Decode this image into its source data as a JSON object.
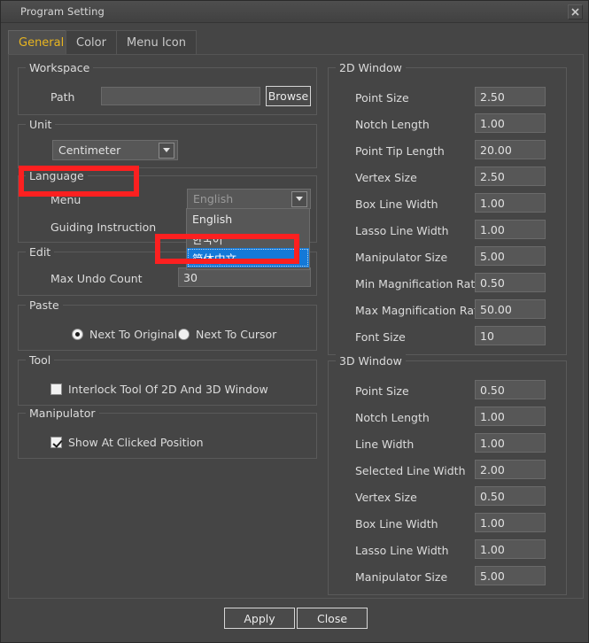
{
  "window": {
    "title": "Program Setting",
    "close_icon": "close-x-icon"
  },
  "tabs": [
    {
      "label": "General",
      "active": true
    },
    {
      "label": "Color",
      "active": false
    },
    {
      "label": "Menu Icon",
      "active": false
    }
  ],
  "left_panel": {
    "workspace": {
      "legend": "Workspace",
      "path_label": "Path",
      "path_value": "",
      "path_placeholder": "",
      "browse_label": "Browse"
    },
    "unit": {
      "legend": "Unit",
      "value": "Centimeter",
      "options": [
        "Centimeter"
      ],
      "arrow_icon": "chevron-down-icon"
    },
    "language": {
      "legend": "Language",
      "menu_label": "Menu",
      "guiding_label": "Guiding Instruction",
      "menu_value": "English",
      "arrow_icon": "chevron-down-icon",
      "dropdown_options": [
        {
          "label": "English",
          "selected": false
        },
        {
          "label": "한국어",
          "selected": false
        },
        {
          "label": "简体中文",
          "selected": true
        }
      ]
    },
    "edit": {
      "legend": "Edit",
      "max_undo_label": "Max Undo Count",
      "max_undo_value": "30"
    },
    "paste": {
      "legend": "Paste",
      "options": [
        {
          "label": "Next To Original",
          "checked": true
        },
        {
          "label": "Next To Cursor",
          "checked": false
        }
      ]
    },
    "tool": {
      "legend": "Tool",
      "interlock_label": "Interlock Tool Of 2D And 3D Window",
      "interlock_checked": false
    },
    "manipulator": {
      "legend": "Manipulator",
      "show_label": "Show At Clicked Position",
      "show_checked": true
    }
  },
  "right_panel": {
    "window_2d": {
      "legend": "2D Window",
      "fields": [
        {
          "label": "Point Size",
          "value": "2.50"
        },
        {
          "label": "Notch Length",
          "value": "1.00"
        },
        {
          "label": "Point Tip Length",
          "value": "20.00"
        },
        {
          "label": "Vertex Size",
          "value": "2.50"
        },
        {
          "label": "Box Line Width",
          "value": "1.00"
        },
        {
          "label": "Lasso Line Width",
          "value": "1.00"
        },
        {
          "label": "Manipulator Size",
          "value": "5.00"
        },
        {
          "label": "Min Magnification Ratio",
          "value": "0.50"
        },
        {
          "label": "Max Magnification Ratio",
          "value": "50.00"
        },
        {
          "label": "Font Size",
          "value": "10"
        }
      ]
    },
    "window_3d": {
      "legend": "3D Window",
      "fields": [
        {
          "label": "Point Size",
          "value": "0.50"
        },
        {
          "label": "Notch Length",
          "value": "1.00"
        },
        {
          "label": "Line Width",
          "value": "1.00"
        },
        {
          "label": "Selected Line Width",
          "value": "2.00"
        },
        {
          "label": "Vertex Size",
          "value": "0.50"
        },
        {
          "label": "Box Line Width",
          "value": "1.00"
        },
        {
          "label": "Lasso Line Width",
          "value": "1.00"
        },
        {
          "label": "Manipulator Size",
          "value": "5.00"
        }
      ]
    }
  },
  "footer": {
    "apply_label": "Apply",
    "close_label": "Close"
  },
  "annotations": {
    "highlight_color": "#fc2020",
    "boxes": [
      {
        "name": "language-group-highlight"
      },
      {
        "name": "simplified-chinese-option-highlight"
      }
    ]
  }
}
